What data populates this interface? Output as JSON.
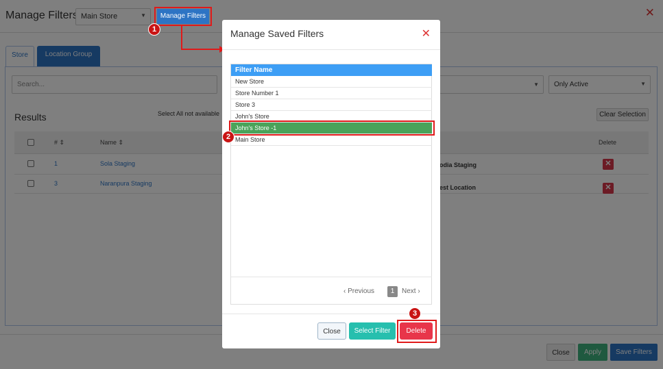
{
  "header": {
    "title": "Manage Filters",
    "store_select": "Main Store",
    "manage_filters_btn": "Manage Filters",
    "close": "✕"
  },
  "tabs": [
    {
      "label": "Store"
    },
    {
      "label": "Location Group"
    }
  ],
  "panel": {
    "search_placeholder": "Search...",
    "status_select": "Only Active",
    "results_title": "Results",
    "select_all_text": "Select All not available",
    "clear_selection": "Clear Selection",
    "columns": {
      "num": "#",
      "name": "Name",
      "delete": "Delete"
    },
    "rows": [
      {
        "num": "1",
        "name": "Sola Staging",
        "location": "odia Staging"
      },
      {
        "num": "3",
        "name": "Naranpura Staging",
        "location": "est Location"
      }
    ]
  },
  "footer": {
    "close": "Close",
    "apply": "Apply",
    "save": "Save Filters"
  },
  "modal": {
    "title": "Manage Saved Filters",
    "close": "✕",
    "list_header": "Filter Name",
    "items": [
      "New Store",
      "Store Number 1",
      "Store 3",
      "John's Store",
      "John's Store -1",
      "Main Store"
    ],
    "selected_index": 4,
    "pager": {
      "previous": "Previous",
      "page": "1",
      "next": "Next"
    },
    "buttons": {
      "close": "Close",
      "select": "Select Filter",
      "delete": "Delete"
    }
  },
  "annotations": {
    "badge1": "1",
    "badge2": "2",
    "badge3": "3"
  },
  "colors": {
    "primary": "#2d74c4",
    "selected_row": "#4aa35a",
    "delete": "#e8354a",
    "select_filter": "#26bfae",
    "annotation": "#e01919"
  }
}
